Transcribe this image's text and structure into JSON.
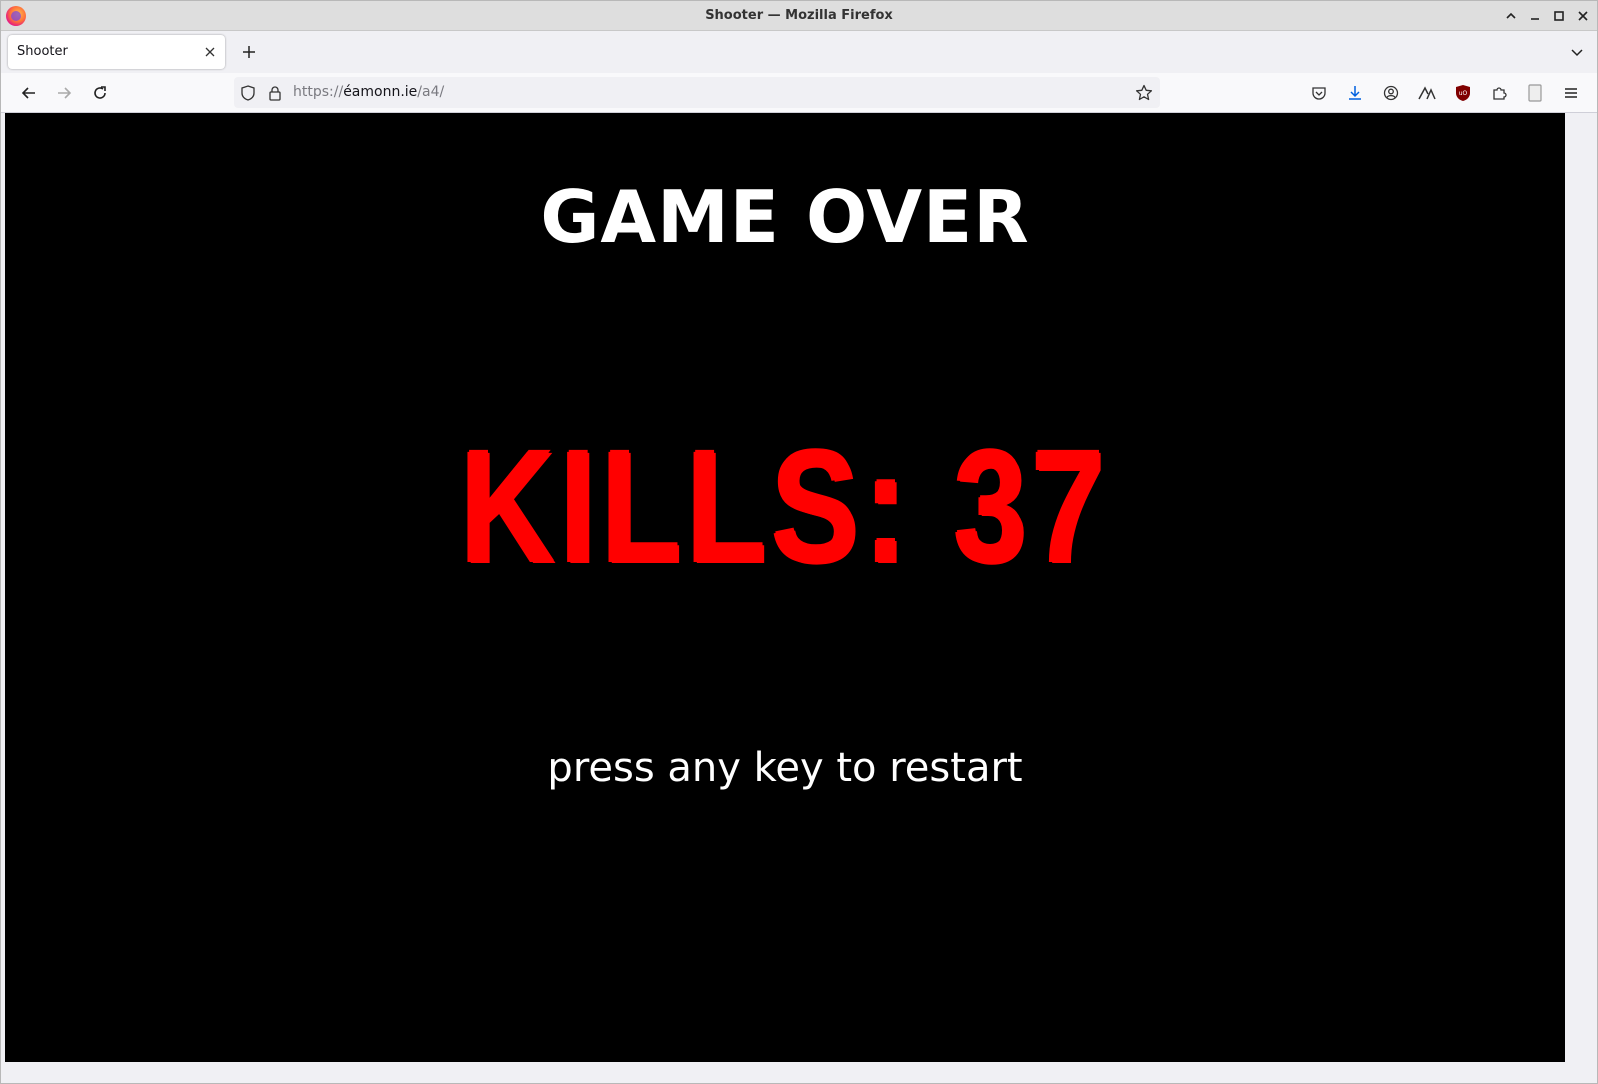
{
  "window": {
    "title": "Shooter — Mozilla Firefox"
  },
  "tabs": [
    {
      "label": "Shooter",
      "active": true
    }
  ],
  "navbar": {
    "url_scheme": "https://",
    "url_host": "éamonn.ie",
    "url_path": "/a4/"
  },
  "game": {
    "heading": "GAME OVER",
    "kills_label": "KILLS: 37",
    "kills": 37,
    "restart_hint": "press any key to restart",
    "colors": {
      "background": "#000000",
      "heading": "#ffffff",
      "kills": "#ff0000"
    }
  },
  "icons": {
    "toolbar": [
      "pocket-icon",
      "downloads-icon",
      "account-icon",
      "extension-a-icon",
      "ublock-icon",
      "extensions-icon",
      "reader-icon",
      "menu-icon"
    ]
  }
}
